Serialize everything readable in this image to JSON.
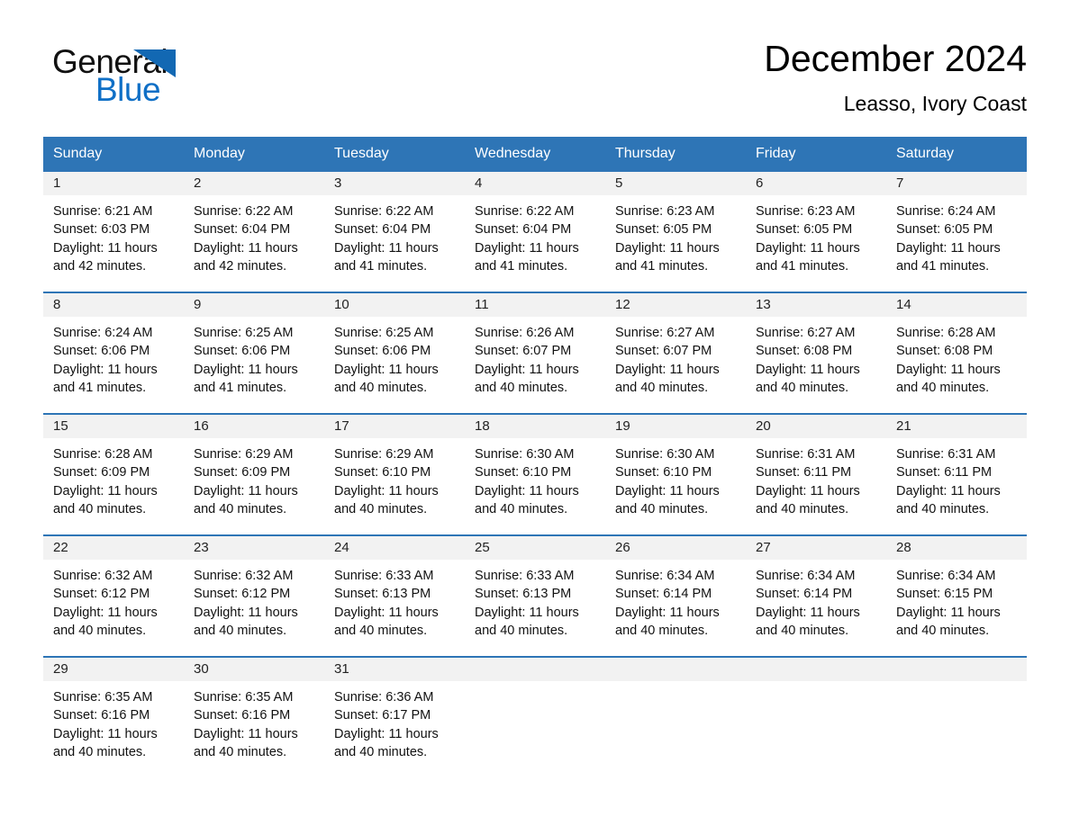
{
  "brand": {
    "name_part1": "General",
    "name_part2": "Blue",
    "triangle_color": "#1268B3",
    "blue_text_color": "#0F6FC6"
  },
  "header": {
    "title": "December 2024",
    "subtitle": "Leasso, Ivory Coast",
    "accent_color": "#2E75B6",
    "date_strip_color": "#F2F2F2"
  },
  "weekdays": [
    "Sunday",
    "Monday",
    "Tuesday",
    "Wednesday",
    "Thursday",
    "Friday",
    "Saturday"
  ],
  "weeks": [
    [
      {
        "date": "1",
        "sunrise": "Sunrise: 6:21 AM",
        "sunset": "Sunset: 6:03 PM",
        "daylight": "Daylight: 11 hours and 42 minutes."
      },
      {
        "date": "2",
        "sunrise": "Sunrise: 6:22 AM",
        "sunset": "Sunset: 6:04 PM",
        "daylight": "Daylight: 11 hours and 42 minutes."
      },
      {
        "date": "3",
        "sunrise": "Sunrise: 6:22 AM",
        "sunset": "Sunset: 6:04 PM",
        "daylight": "Daylight: 11 hours and 41 minutes."
      },
      {
        "date": "4",
        "sunrise": "Sunrise: 6:22 AM",
        "sunset": "Sunset: 6:04 PM",
        "daylight": "Daylight: 11 hours and 41 minutes."
      },
      {
        "date": "5",
        "sunrise": "Sunrise: 6:23 AM",
        "sunset": "Sunset: 6:05 PM",
        "daylight": "Daylight: 11 hours and 41 minutes."
      },
      {
        "date": "6",
        "sunrise": "Sunrise: 6:23 AM",
        "sunset": "Sunset: 6:05 PM",
        "daylight": "Daylight: 11 hours and 41 minutes."
      },
      {
        "date": "7",
        "sunrise": "Sunrise: 6:24 AM",
        "sunset": "Sunset: 6:05 PM",
        "daylight": "Daylight: 11 hours and 41 minutes."
      }
    ],
    [
      {
        "date": "8",
        "sunrise": "Sunrise: 6:24 AM",
        "sunset": "Sunset: 6:06 PM",
        "daylight": "Daylight: 11 hours and 41 minutes."
      },
      {
        "date": "9",
        "sunrise": "Sunrise: 6:25 AM",
        "sunset": "Sunset: 6:06 PM",
        "daylight": "Daylight: 11 hours and 41 minutes."
      },
      {
        "date": "10",
        "sunrise": "Sunrise: 6:25 AM",
        "sunset": "Sunset: 6:06 PM",
        "daylight": "Daylight: 11 hours and 40 minutes."
      },
      {
        "date": "11",
        "sunrise": "Sunrise: 6:26 AM",
        "sunset": "Sunset: 6:07 PM",
        "daylight": "Daylight: 11 hours and 40 minutes."
      },
      {
        "date": "12",
        "sunrise": "Sunrise: 6:27 AM",
        "sunset": "Sunset: 6:07 PM",
        "daylight": "Daylight: 11 hours and 40 minutes."
      },
      {
        "date": "13",
        "sunrise": "Sunrise: 6:27 AM",
        "sunset": "Sunset: 6:08 PM",
        "daylight": "Daylight: 11 hours and 40 minutes."
      },
      {
        "date": "14",
        "sunrise": "Sunrise: 6:28 AM",
        "sunset": "Sunset: 6:08 PM",
        "daylight": "Daylight: 11 hours and 40 minutes."
      }
    ],
    [
      {
        "date": "15",
        "sunrise": "Sunrise: 6:28 AM",
        "sunset": "Sunset: 6:09 PM",
        "daylight": "Daylight: 11 hours and 40 minutes."
      },
      {
        "date": "16",
        "sunrise": "Sunrise: 6:29 AM",
        "sunset": "Sunset: 6:09 PM",
        "daylight": "Daylight: 11 hours and 40 minutes."
      },
      {
        "date": "17",
        "sunrise": "Sunrise: 6:29 AM",
        "sunset": "Sunset: 6:10 PM",
        "daylight": "Daylight: 11 hours and 40 minutes."
      },
      {
        "date": "18",
        "sunrise": "Sunrise: 6:30 AM",
        "sunset": "Sunset: 6:10 PM",
        "daylight": "Daylight: 11 hours and 40 minutes."
      },
      {
        "date": "19",
        "sunrise": "Sunrise: 6:30 AM",
        "sunset": "Sunset: 6:10 PM",
        "daylight": "Daylight: 11 hours and 40 minutes."
      },
      {
        "date": "20",
        "sunrise": "Sunrise: 6:31 AM",
        "sunset": "Sunset: 6:11 PM",
        "daylight": "Daylight: 11 hours and 40 minutes."
      },
      {
        "date": "21",
        "sunrise": "Sunrise: 6:31 AM",
        "sunset": "Sunset: 6:11 PM",
        "daylight": "Daylight: 11 hours and 40 minutes."
      }
    ],
    [
      {
        "date": "22",
        "sunrise": "Sunrise: 6:32 AM",
        "sunset": "Sunset: 6:12 PM",
        "daylight": "Daylight: 11 hours and 40 minutes."
      },
      {
        "date": "23",
        "sunrise": "Sunrise: 6:32 AM",
        "sunset": "Sunset: 6:12 PM",
        "daylight": "Daylight: 11 hours and 40 minutes."
      },
      {
        "date": "24",
        "sunrise": "Sunrise: 6:33 AM",
        "sunset": "Sunset: 6:13 PM",
        "daylight": "Daylight: 11 hours and 40 minutes."
      },
      {
        "date": "25",
        "sunrise": "Sunrise: 6:33 AM",
        "sunset": "Sunset: 6:13 PM",
        "daylight": "Daylight: 11 hours and 40 minutes."
      },
      {
        "date": "26",
        "sunrise": "Sunrise: 6:34 AM",
        "sunset": "Sunset: 6:14 PM",
        "daylight": "Daylight: 11 hours and 40 minutes."
      },
      {
        "date": "27",
        "sunrise": "Sunrise: 6:34 AM",
        "sunset": "Sunset: 6:14 PM",
        "daylight": "Daylight: 11 hours and 40 minutes."
      },
      {
        "date": "28",
        "sunrise": "Sunrise: 6:34 AM",
        "sunset": "Sunset: 6:15 PM",
        "daylight": "Daylight: 11 hours and 40 minutes."
      }
    ],
    [
      {
        "date": "29",
        "sunrise": "Sunrise: 6:35 AM",
        "sunset": "Sunset: 6:16 PM",
        "daylight": "Daylight: 11 hours and 40 minutes."
      },
      {
        "date": "30",
        "sunrise": "Sunrise: 6:35 AM",
        "sunset": "Sunset: 6:16 PM",
        "daylight": "Daylight: 11 hours and 40 minutes."
      },
      {
        "date": "31",
        "sunrise": "Sunrise: 6:36 AM",
        "sunset": "Sunset: 6:17 PM",
        "daylight": "Daylight: 11 hours and 40 minutes."
      },
      {
        "date": "",
        "sunrise": "",
        "sunset": "",
        "daylight": ""
      },
      {
        "date": "",
        "sunrise": "",
        "sunset": "",
        "daylight": ""
      },
      {
        "date": "",
        "sunrise": "",
        "sunset": "",
        "daylight": ""
      },
      {
        "date": "",
        "sunrise": "",
        "sunset": "",
        "daylight": ""
      }
    ]
  ]
}
